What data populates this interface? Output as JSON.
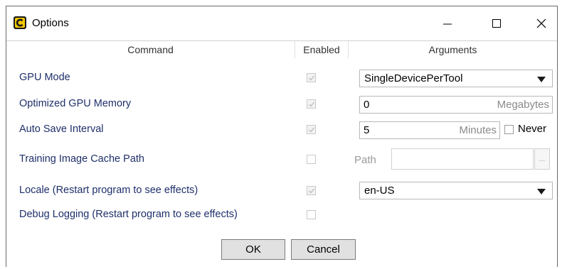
{
  "window": {
    "title": "Options",
    "icon": "app-logo-icon"
  },
  "columns": {
    "command": "Command",
    "enabled": "Enabled",
    "arguments": "Arguments"
  },
  "rows": [
    {
      "command": "GPU Mode",
      "enabled": true,
      "argument": {
        "type": "select",
        "value": "SingleDevicePerTool"
      }
    },
    {
      "command": "Optimized GPU Memory",
      "enabled": true,
      "argument": {
        "type": "number",
        "value": "0",
        "unit": "Megabytes"
      }
    },
    {
      "command": "Auto Save Interval",
      "enabled": true,
      "argument": {
        "type": "number",
        "value": "5",
        "unit": "Minutes",
        "extra_checkbox": {
          "label": "Never",
          "checked": false
        }
      }
    },
    {
      "command": "Training Image Cache Path",
      "enabled": false,
      "argument": {
        "type": "path",
        "label": "Path",
        "value": "",
        "browse_label": "..."
      }
    },
    {
      "command": "Locale (Restart program to see effects)",
      "enabled": true,
      "argument": {
        "type": "select",
        "value": "en-US"
      }
    },
    {
      "command": "Debug Logging (Restart program to see effects)",
      "enabled": false,
      "argument": null
    }
  ],
  "buttons": {
    "ok": "OK",
    "cancel": "Cancel"
  },
  "colors": {
    "command_text": "#1f2f6a",
    "button_bg": "#e1e1e1",
    "border": "#6b6b6b"
  }
}
